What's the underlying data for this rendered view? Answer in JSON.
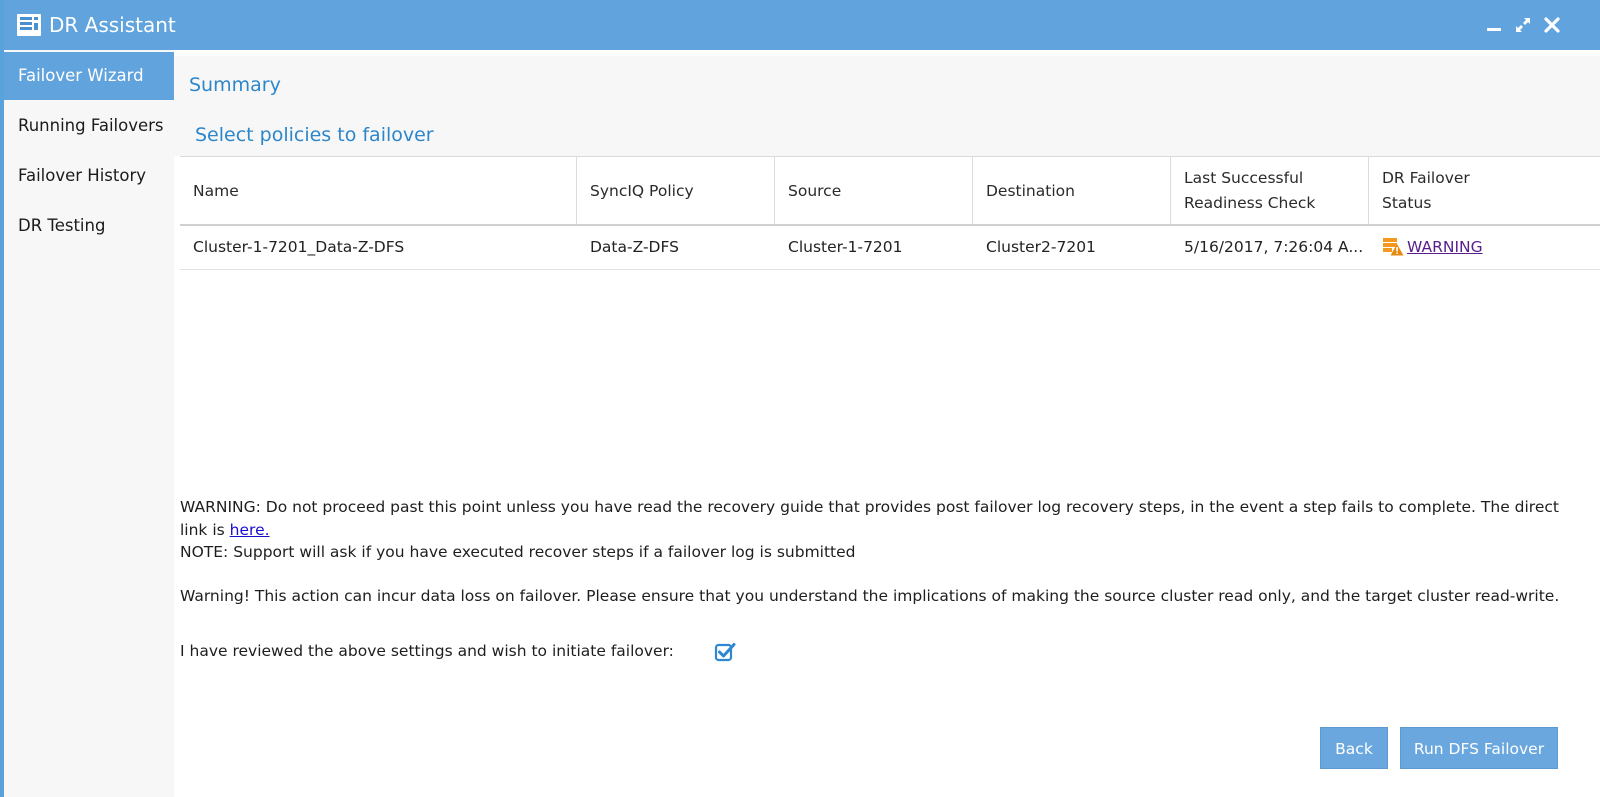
{
  "window": {
    "title": "DR Assistant",
    "accent_color": "#61a3dd",
    "controls": [
      "minimize-icon",
      "maximize-icon",
      "close-icon"
    ]
  },
  "sidebar": {
    "items": [
      {
        "label": "Failover Wizard",
        "active": true
      },
      {
        "label": "Running Failovers",
        "active": false
      },
      {
        "label": "Failover History",
        "active": false
      },
      {
        "label": "DR Testing",
        "active": false
      }
    ]
  },
  "main": {
    "summary_title": "Summary",
    "section_title": "Select policies to failover",
    "table": {
      "headers": [
        "Name",
        "SyncIQ Policy",
        "Source",
        "Destination",
        "Last Successful Readiness Check",
        "DR Failover Status"
      ],
      "rows": [
        {
          "name": "Cluster-1-7201_Data-Z-DFS",
          "synciq_policy": "Data-Z-DFS",
          "source": "Cluster-1-7201",
          "destination": "Cluster2-7201",
          "last_check": "5/16/2017, 7:26:04 A...",
          "status": "WARNING",
          "status_icon": "warning-icon",
          "status_color": "#f29a1f"
        }
      ]
    },
    "warning_text": "WARNING: Do not proceed past this point unless you have read the recovery guide that provides post failover log recovery steps, in the event a step fails to complete. The direct link is",
    "warning_link": "here.",
    "note_text": "NOTE: Support will ask if you have executed recover steps if a failover log is submitted",
    "data_loss_warning": "Warning! This action can incur data loss on failover. Please ensure that you understand the implications of making the source cluster read only, and the target cluster read-write.",
    "confirm_label": "I have reviewed the above settings and wish to initiate failover:",
    "confirm_checked": true
  },
  "buttons": {
    "back": "Back",
    "run": "Run DFS Failover"
  }
}
